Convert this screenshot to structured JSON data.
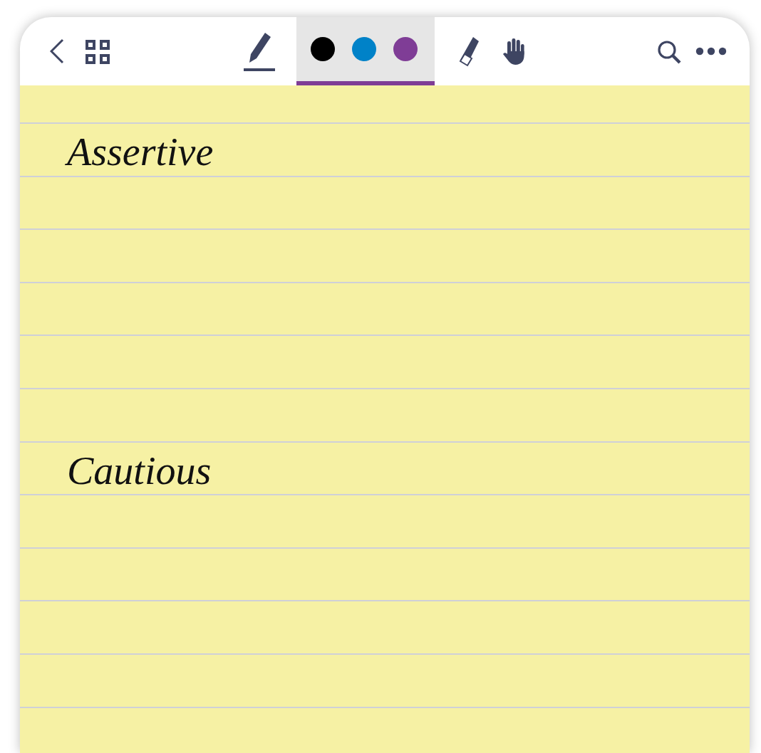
{
  "toolbar": {
    "left": [
      {
        "kind": "back"
      },
      {
        "kind": "grid"
      }
    ],
    "tools": [
      {
        "kind": "pen",
        "selected": true
      }
    ],
    "colors": [
      {
        "color": "#000000"
      },
      {
        "color": "#0082c8"
      },
      {
        "color": "#7f3d96"
      }
    ],
    "colors_selected": true,
    "right_tools": [
      {
        "kind": "eraser"
      },
      {
        "kind": "hand"
      }
    ],
    "actions": [
      {
        "kind": "search"
      },
      {
        "kind": "more"
      }
    ]
  },
  "notes": [
    {
      "text": "Assertive"
    },
    {
      "text": "Cautious"
    }
  ]
}
